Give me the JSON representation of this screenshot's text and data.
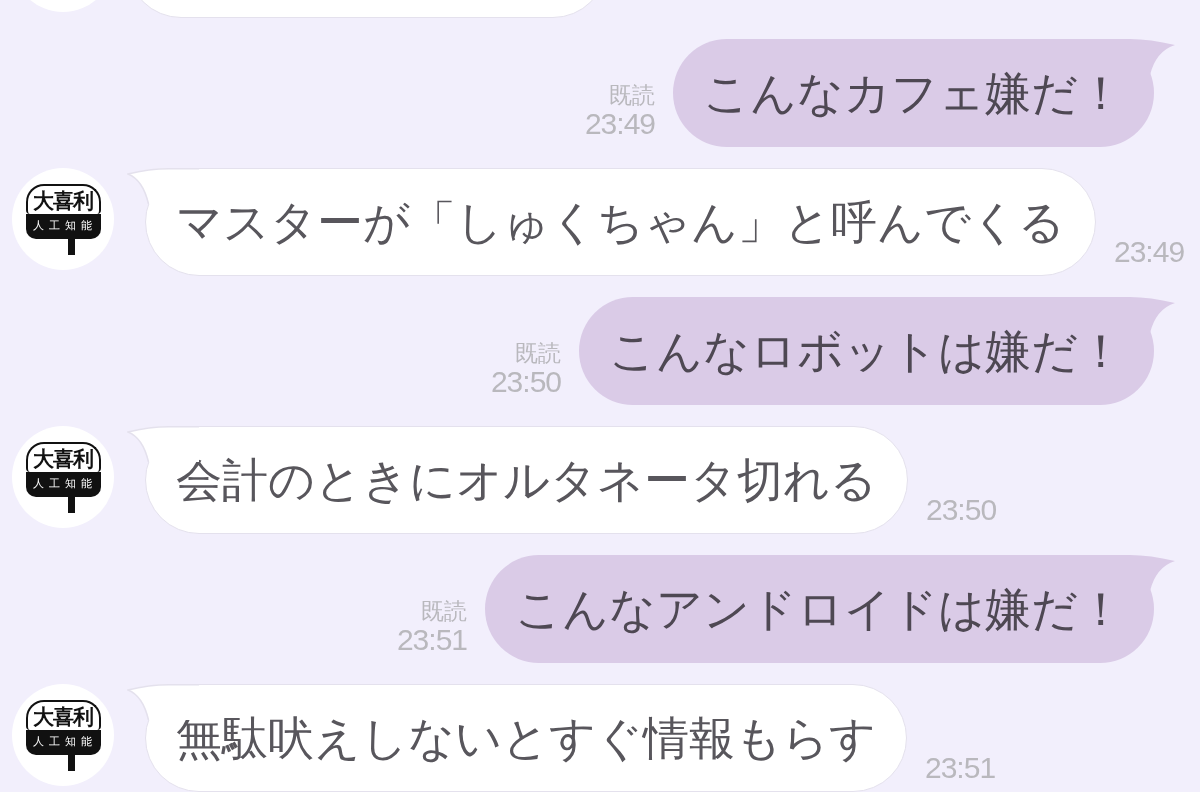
{
  "chat": {
    "messages": [
      {
        "kind": "incoming",
        "cut_off": true
      },
      {
        "kind": "outgoing",
        "cut_off": false,
        "read_label": "既読",
        "time": "23:49",
        "text": "こんなカフェ嫌だ！"
      },
      {
        "kind": "incoming",
        "cut_off": false,
        "avatar": {
          "title": "大喜利",
          "subtitle": "人工知能"
        },
        "text": "マスターが「しゅくちゃん」と呼んでくる",
        "time": "23:49"
      },
      {
        "kind": "outgoing",
        "cut_off": false,
        "read_label": "既読",
        "time": "23:50",
        "text": "こんなロボットは嫌だ！"
      },
      {
        "kind": "incoming",
        "cut_off": false,
        "avatar": {
          "title": "大喜利",
          "subtitle": "人工知能"
        },
        "text": "会計のときにオルタネータ切れる",
        "time": "23:50"
      },
      {
        "kind": "outgoing",
        "cut_off": false,
        "read_label": "既読",
        "time": "23:51",
        "text": "こんなアンドロイドは嫌だ！"
      },
      {
        "kind": "incoming",
        "cut_off": false,
        "avatar": {
          "title": "大喜利",
          "subtitle": "人工知能"
        },
        "text": "無駄吠えしないとすぐ情報もらす",
        "time": "23:51"
      }
    ]
  }
}
